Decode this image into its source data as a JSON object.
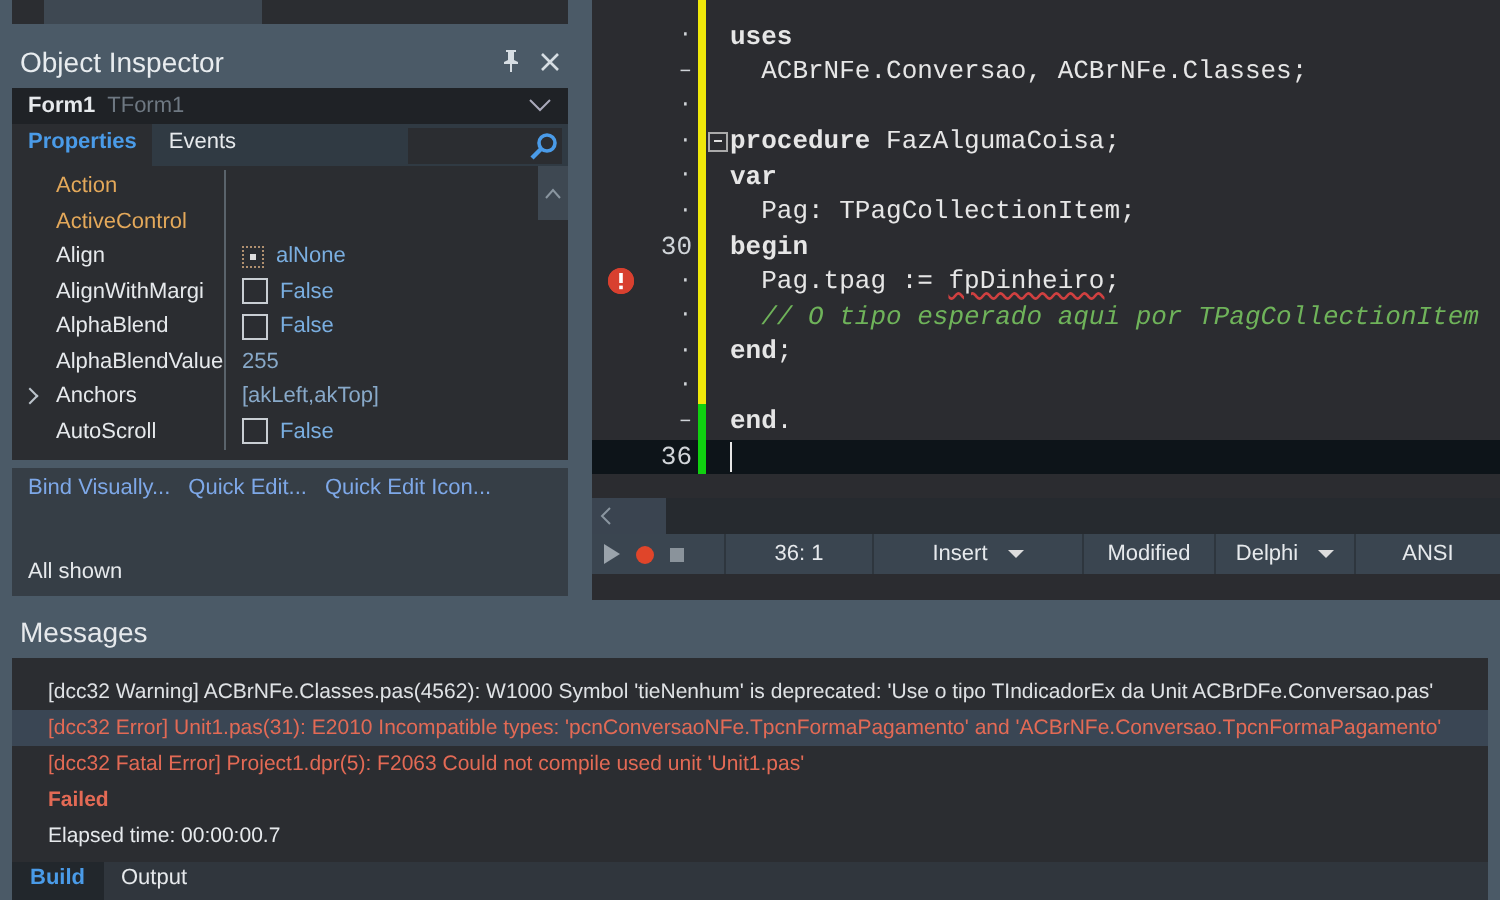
{
  "inspector": {
    "title": "Object Inspector",
    "object_name": "Form1",
    "object_type": "TForm1",
    "tabs": [
      {
        "label": "Properties",
        "selected": true
      },
      {
        "label": "Events",
        "selected": false
      }
    ],
    "properties": [
      {
        "name": "Action",
        "kind": "reference"
      },
      {
        "name": "ActiveControl",
        "kind": "reference"
      },
      {
        "name": "Align",
        "kind": "enum",
        "value": "alNone"
      },
      {
        "name": "AlignWithMargi",
        "kind": "boolean",
        "checked": false,
        "value": "False"
      },
      {
        "name": "AlphaBlend",
        "kind": "boolean",
        "checked": false,
        "value": "False"
      },
      {
        "name": "AlphaBlendValue",
        "kind": "plain",
        "value": "255"
      },
      {
        "name": "Anchors",
        "kind": "set",
        "expanded": false,
        "value": "[akLeft,akTop]"
      },
      {
        "name": "AutoScroll",
        "kind": "boolean",
        "checked": false,
        "value": "False"
      }
    ],
    "links": [
      "Bind Visually...",
      "Quick Edit...",
      "Quick Edit Icon..."
    ],
    "footer": "All shown"
  },
  "editor": {
    "lines": [
      {
        "saved": false
      },
      {
        "gutter": "·",
        "saved": false,
        "tokens": [
          {
            "text": "uses",
            "kind": "keyword"
          }
        ]
      },
      {
        "gutter": "–",
        "saved": false,
        "tokens": [
          {
            "text": "  ACBrNFe.Conversao, ACBrNFe.Classes;",
            "kind": "plain"
          }
        ]
      },
      {
        "gutter": "·",
        "saved": false
      },
      {
        "gutter": "·",
        "saved": false,
        "fold": true,
        "tokens": [
          {
            "text": "procedure",
            "kind": "keyword"
          },
          {
            "text": " FazAlgumaCoisa;",
            "kind": "plain"
          }
        ]
      },
      {
        "gutter": "·",
        "saved": false,
        "tokens": [
          {
            "text": "var",
            "kind": "keyword"
          }
        ]
      },
      {
        "gutter": "·",
        "saved": false,
        "tokens": [
          {
            "text": "  Pag: TPagCollectionItem;",
            "kind": "plain"
          }
        ]
      },
      {
        "gutter": "30",
        "saved": false,
        "tokens": [
          {
            "text": "begin",
            "kind": "keyword"
          }
        ]
      },
      {
        "gutter": "·",
        "saved": false,
        "error": true,
        "tokens": [
          {
            "text": "  Pag.tpag := ",
            "kind": "plain"
          },
          {
            "text": "fpDinheiro",
            "kind": "squiggle"
          },
          {
            "text": ";",
            "kind": "plain"
          }
        ]
      },
      {
        "gutter": "·",
        "saved": false,
        "tokens": [
          {
            "text": "  // O tipo esperado aqui por TPagCollectionItem",
            "kind": "comment"
          }
        ]
      },
      {
        "gutter": "·",
        "saved": false,
        "tokens": [
          {
            "text": "end",
            "kind": "keyword"
          },
          {
            "text": ";",
            "kind": "plain"
          }
        ]
      },
      {
        "gutter": "·",
        "saved": false
      },
      {
        "gutter": "–",
        "saved": true,
        "tokens": [
          {
            "text": "end",
            "kind": "keyword"
          },
          {
            "text": ".",
            "kind": "plain"
          }
        ]
      },
      {
        "gutter": "36",
        "saved": true,
        "current": true
      }
    ],
    "status": {
      "position": "36:  1",
      "mode": "Insert",
      "modified": "Modified",
      "language": "Delphi",
      "encoding": "ANSI"
    }
  },
  "messages": {
    "title": "Messages",
    "items": [
      {
        "kind": "warning",
        "selected": false,
        "text": "[dcc32 Warning] ACBrNFe.Classes.pas(4562): W1000 Symbol 'tieNenhum' is deprecated: 'Use o tipo TIndicadorEx da Unit ACBrDFe.Conversao.pas'"
      },
      {
        "kind": "error",
        "selected": true,
        "text": "[dcc32 Error] Unit1.pas(31): E2010 Incompatible types: 'pcnConversaoNFe.TpcnFormaPagamento' and 'ACBrNFe.Conversao.TpcnFormaPagamento'"
      },
      {
        "kind": "error",
        "selected": false,
        "text": "[dcc32 Fatal Error] Project1.dpr(5): F2063 Could not compile used unit 'Unit1.pas'"
      },
      {
        "kind": "failed",
        "selected": false,
        "text": "Failed"
      },
      {
        "kind": "info",
        "selected": false,
        "text": "Elapsed time: 00:00:00.7"
      }
    ],
    "tabs": [
      {
        "label": "Build",
        "selected": true
      },
      {
        "label": "Output",
        "selected": false
      }
    ]
  }
}
